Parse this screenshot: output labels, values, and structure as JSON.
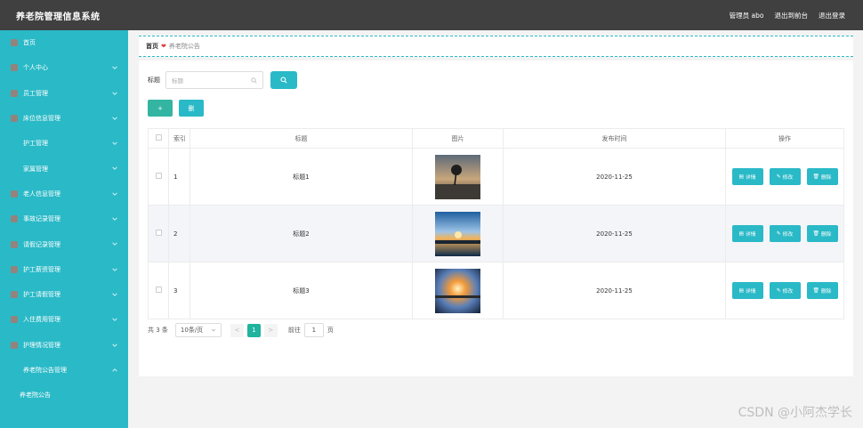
{
  "app": {
    "title": "养老院管理信息系统",
    "user": "管理员 abo",
    "back_to_admin": "退出到前台",
    "logout": "退出登录"
  },
  "colors": {
    "accent": "#2ab9c7",
    "topbar": "#404040",
    "active_page": "#20b39d"
  },
  "sidebar": {
    "items": [
      {
        "label": "首页",
        "icon": "home-icon",
        "has_chevron": false
      },
      {
        "label": "个人中心",
        "icon": "user-icon",
        "has_chevron": true
      },
      {
        "label": "员工管理",
        "icon": "staff-icon",
        "has_chevron": true
      },
      {
        "label": "床位信息管理",
        "icon": "bed-icon",
        "has_chevron": true
      },
      {
        "label": "护工管理",
        "icon": "nurse-icon",
        "has_chevron": true
      },
      {
        "label": "家属管理",
        "icon": "family-icon",
        "has_chevron": true
      },
      {
        "label": "老人信息管理",
        "icon": "elder-icon",
        "has_chevron": true
      },
      {
        "label": "事故记录管理",
        "icon": "accident-icon",
        "has_chevron": true
      },
      {
        "label": "请假记录管理",
        "icon": "leave-icon",
        "has_chevron": true
      },
      {
        "label": "护工薪资管理",
        "icon": "salary-icon",
        "has_chevron": true
      },
      {
        "label": "护工请假管理",
        "icon": "nurse-leave-icon",
        "has_chevron": true
      },
      {
        "label": "入住费用管理",
        "icon": "fee-icon",
        "has_chevron": true
      },
      {
        "label": "护理情况管理",
        "icon": "care-icon",
        "has_chevron": true
      },
      {
        "label": "养老院公告管理",
        "icon": "notice-icon",
        "has_chevron": true,
        "expanded": true
      }
    ],
    "subitem": "养老院公告"
  },
  "breadcrumb": {
    "home": "首页",
    "heart": "❤",
    "current": "养老院公告"
  },
  "search": {
    "label": "标题",
    "placeholder": "标题"
  },
  "actions": {
    "add": "+",
    "delete": "删"
  },
  "table": {
    "headers": [
      "",
      "索引",
      "标题",
      "图片",
      "发布时间",
      "操作"
    ],
    "rows": [
      {
        "index": "1",
        "title": "标题1",
        "date": "2020-11-25"
      },
      {
        "index": "2",
        "title": "标题2",
        "date": "2020-11-25"
      },
      {
        "index": "3",
        "title": "标题3",
        "date": "2020-11-25"
      }
    ],
    "ops": {
      "detail": "详情",
      "edit": "修改",
      "delete": "删除"
    }
  },
  "pager": {
    "total": "共 3 条",
    "page_size": "10条/页",
    "prev": "<",
    "current_page": "1",
    "next": ">",
    "goto": "前往",
    "goto_value": "1",
    "page_unit": "页"
  },
  "watermark": "CSDN @小阿杰学长"
}
